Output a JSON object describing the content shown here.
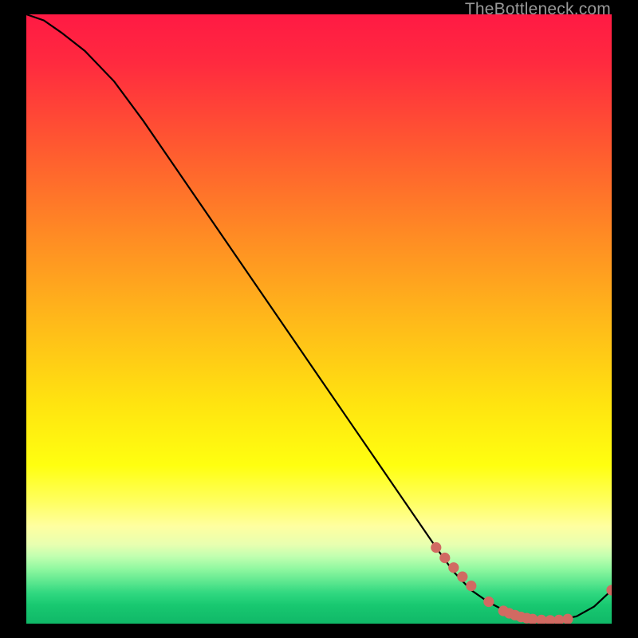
{
  "watermark": "TheBottleneck.com",
  "chart_data": {
    "type": "line",
    "title": "",
    "xlabel": "",
    "ylabel": "",
    "xlim": [
      0,
      100
    ],
    "ylim": [
      0,
      100
    ],
    "curve": {
      "x": [
        0,
        3,
        6,
        10,
        15,
        20,
        25,
        30,
        35,
        40,
        45,
        50,
        55,
        60,
        65,
        70,
        73,
        76,
        79,
        82,
        85,
        88,
        91,
        94,
        97,
        100
      ],
      "y": [
        100,
        99,
        97,
        94,
        89,
        82.5,
        75.5,
        68.5,
        61.5,
        54.5,
        47.5,
        40.5,
        33.5,
        26.5,
        19.5,
        12.5,
        8.5,
        5.5,
        3.5,
        2.0,
        1.1,
        0.6,
        0.6,
        1.2,
        2.8,
        5.5
      ]
    },
    "dots": {
      "x": [
        70,
        71.5,
        73,
        74.5,
        76,
        79,
        81.5,
        82.5,
        83.5,
        84.5,
        85.5,
        86.5,
        88,
        89.5,
        91,
        92.5,
        100
      ],
      "y": [
        12.5,
        10.8,
        9.2,
        7.7,
        6.2,
        3.6,
        2.1,
        1.7,
        1.4,
        1.1,
        0.9,
        0.75,
        0.6,
        0.55,
        0.6,
        0.75,
        5.5
      ],
      "color": "#d16a62",
      "radius_data_units": 0.9
    },
    "gradient_note": "Vertical rainbow gradient from red (top) through orange/yellow to green (bottom). No visible axis ticks or labels are shown."
  }
}
